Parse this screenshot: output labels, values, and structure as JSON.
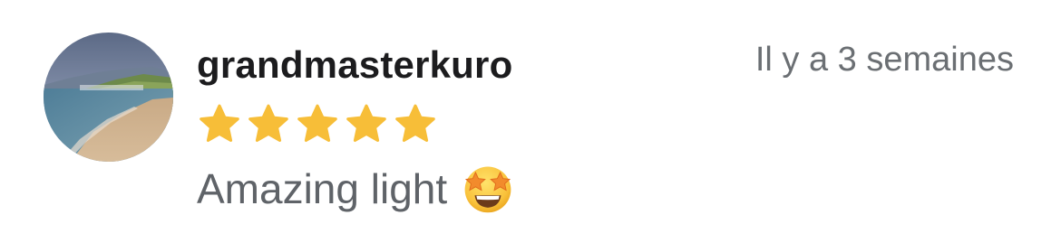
{
  "review": {
    "username": "grandmasterkuro",
    "timestamp": "Il y a 3 semaines",
    "rating": 5,
    "rating_max": 5,
    "comment": "Amazing light",
    "emoji": "star-struck-emoji",
    "star_color": "#F7BE38",
    "avatar": "beach-landscape-photo"
  }
}
